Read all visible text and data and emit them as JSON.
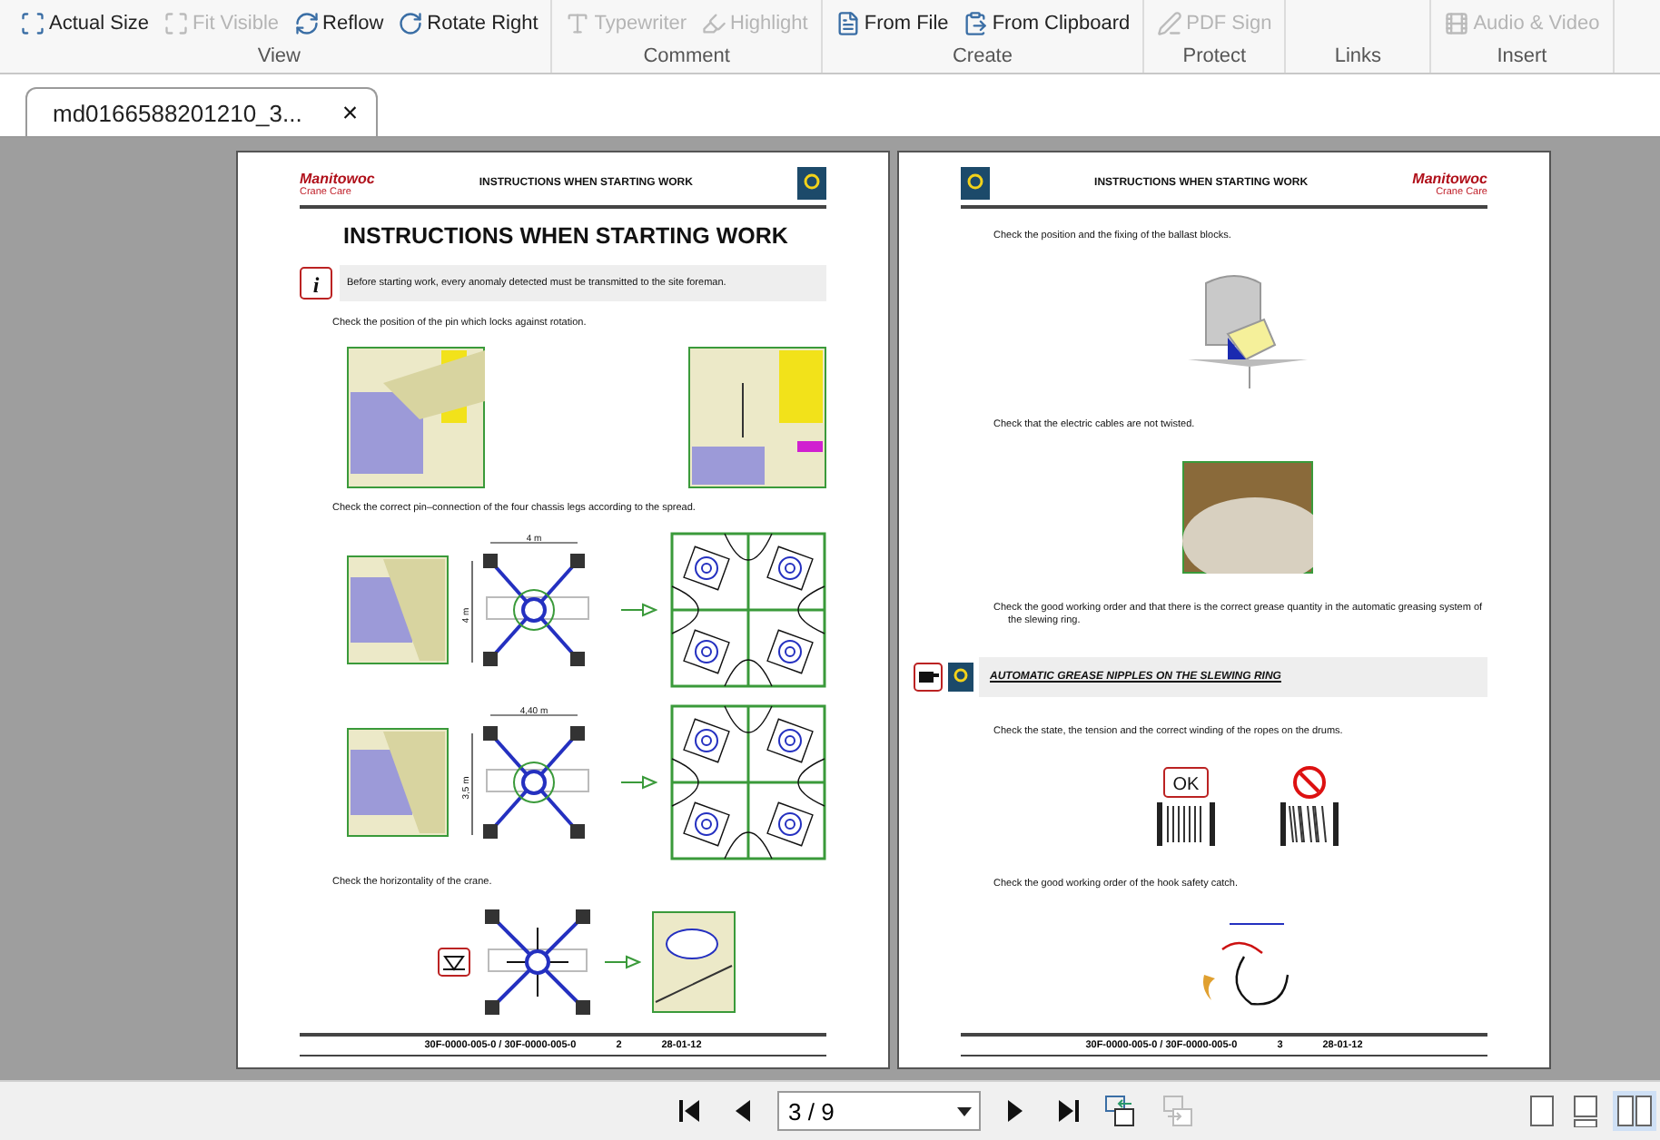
{
  "ribbon": {
    "groups": [
      {
        "label": "View",
        "items": [
          {
            "label": "Actual Size",
            "disabled": false
          },
          {
            "label": "Fit Visible",
            "disabled": true
          },
          {
            "label": "Reflow",
            "disabled": false
          },
          {
            "label": "Rotate Right",
            "disabled": false
          }
        ]
      },
      {
        "label": "Comment",
        "items": [
          {
            "label": "Typewriter",
            "disabled": true
          },
          {
            "label": "Highlight",
            "disabled": true
          }
        ]
      },
      {
        "label": "Create",
        "items": [
          {
            "label": "From File",
            "disabled": false
          },
          {
            "label": "From Clipboard",
            "disabled": false
          }
        ]
      },
      {
        "label": "Protect",
        "items": [
          {
            "label": "PDF Sign",
            "disabled": true
          }
        ]
      },
      {
        "label": "Links"
      },
      {
        "label": "Insert",
        "items": [
          {
            "label": "Audio & Video",
            "disabled": true
          }
        ]
      }
    ]
  },
  "tabs": [
    {
      "label": "md0166588201210_3...",
      "selected": true,
      "close": "×"
    }
  ],
  "pages": [
    {
      "logo_right": false,
      "logo": "Manitowoc",
      "logo_sub": "Crane Care",
      "header_title": "INSTRUCTIONS WHEN STARTING WORK",
      "blocks": [
        {
          "kind": "heading",
          "text": "INSTRUCTIONS WHEN STARTING WORK"
        },
        {
          "kind": "note",
          "marker": "i",
          "text": "Before starting work, every anomaly detected must be transmitted to the site foreman."
        },
        {
          "kind": "bullet",
          "text": "Check the position of the pin which locks against rotation."
        },
        {
          "kind": "pin-photos"
        },
        {
          "kind": "bullet",
          "text": "Check the correct pin–connection of the four chassis legs according to the spread."
        },
        {
          "kind": "spread",
          "labels": [
            "4 m",
            "4 m"
          ]
        },
        {
          "kind": "spread",
          "labels": [
            "4,40 m",
            "3,5 m"
          ]
        },
        {
          "kind": "bullet",
          "text": "Check the horizontality of the crane."
        },
        {
          "kind": "level"
        }
      ],
      "footer": {
        "code": "30F-0000-005-0 / 30F-0000-005-0",
        "number": "2",
        "date": "28-01-12"
      }
    },
    {
      "logo_right": true,
      "logo": "Manitowoc",
      "logo_sub": "Crane Care",
      "header_title": "INSTRUCTIONS WHEN STARTING WORK",
      "blocks": [
        {
          "kind": "bullet",
          "text": "Check the position and the fixing of the ballast blocks."
        },
        {
          "kind": "ballast"
        },
        {
          "kind": "bullet",
          "text": "Check that the electric cables are not twisted."
        },
        {
          "kind": "cables"
        },
        {
          "kind": "bullet",
          "text": "Check the good working order and that there is the correct grease quantity in the automatic greasing system of the slewing ring."
        },
        {
          "kind": "section",
          "text": "AUTOMATIC GREASE NIPPLES ON THE SLEWING RING"
        },
        {
          "kind": "bullet",
          "text": "Check the state, the tension and the correct winding of the ropes on the drums."
        },
        {
          "kind": "drums",
          "labels": [
            "OK"
          ]
        },
        {
          "kind": "bullet",
          "text": "Check the good working order of the hook safety catch."
        },
        {
          "kind": "hook"
        }
      ],
      "footer": {
        "code": "30F-0000-005-0 / 30F-0000-005-0",
        "number": "3",
        "date": "28-01-12"
      }
    }
  ],
  "navigation": {
    "page_field": "3 / 9",
    "view_modes": [
      {
        "selected": false
      },
      {
        "selected": false
      },
      {
        "selected": true
      }
    ]
  }
}
